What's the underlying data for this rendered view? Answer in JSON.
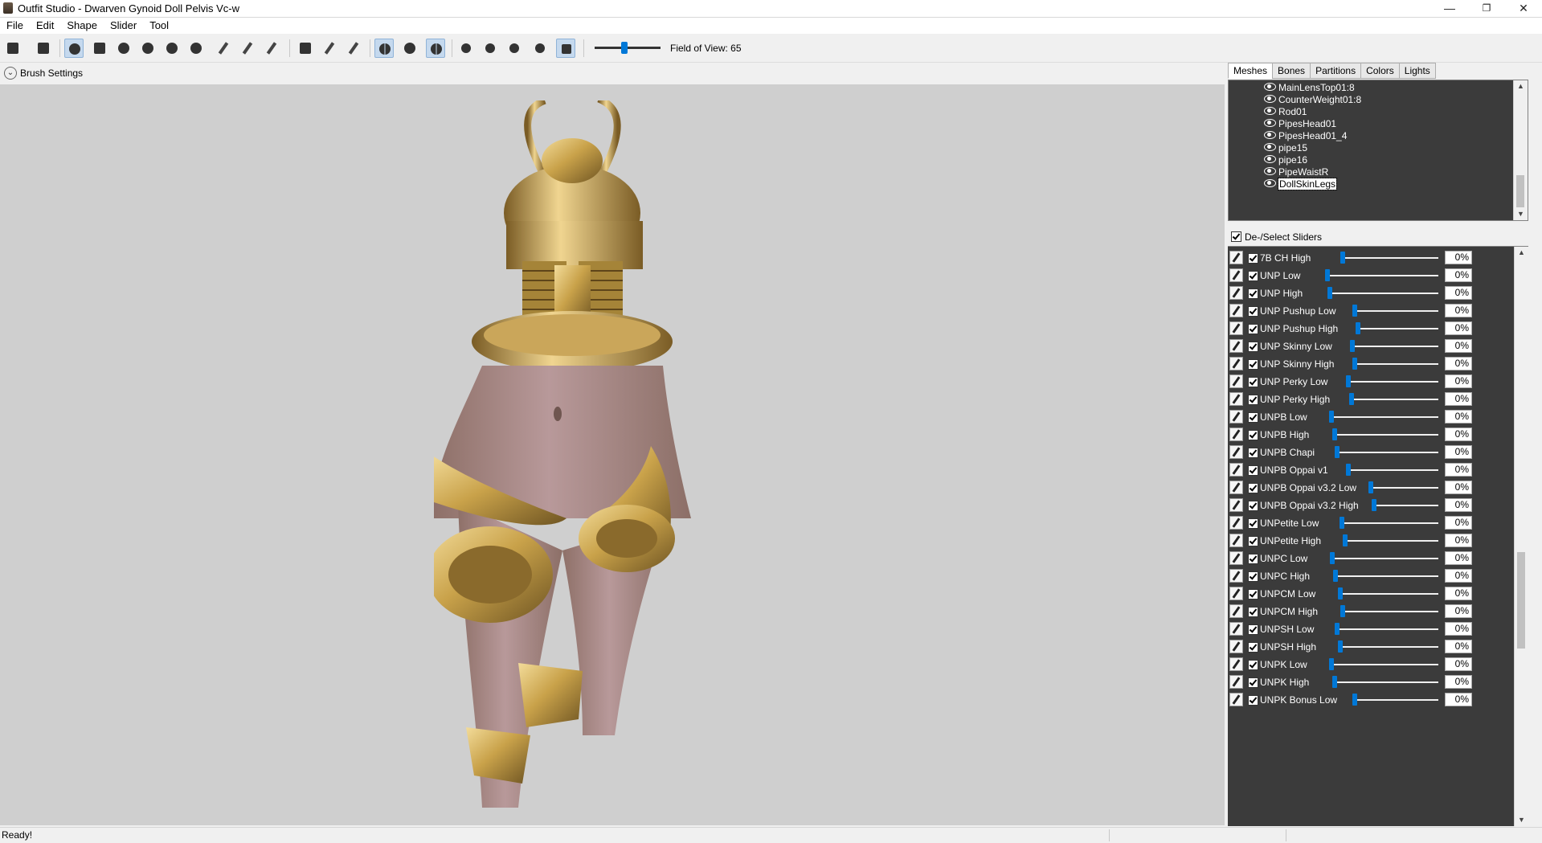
{
  "window": {
    "title": "Outfit Studio - Dwarven Gynoid Doll Pelvis Vc-w",
    "minimize": "—",
    "restore": "❐",
    "close": "✕"
  },
  "menu": [
    "File",
    "Edit",
    "Shape",
    "Slider",
    "Tool"
  ],
  "toolbar": {
    "fov_label": "Field of View: 65",
    "fov_value": 65
  },
  "brush_settings": {
    "label": "Brush Settings"
  },
  "tabs": [
    {
      "label": "Meshes",
      "active": true
    },
    {
      "label": "Bones",
      "active": false
    },
    {
      "label": "Partitions",
      "active": false
    },
    {
      "label": "Colors",
      "active": false
    },
    {
      "label": "Lights",
      "active": false
    }
  ],
  "meshes": [
    "MainLensTop01:8",
    "CounterWeight01:8",
    "Rod01",
    "PipesHead01",
    "PipesHead01_4",
    "pipe15",
    "pipe16",
    "PipeWaistR",
    "DollSkinLegs"
  ],
  "selected_mesh": "DollSkinLegs",
  "deselect_label": "De-/Select Sliders",
  "sliders": [
    {
      "name": "7B CH High",
      "value": "0%"
    },
    {
      "name": "UNP Low",
      "value": "0%"
    },
    {
      "name": "UNP High",
      "value": "0%"
    },
    {
      "name": "UNP Pushup Low",
      "value": "0%"
    },
    {
      "name": "UNP Pushup High",
      "value": "0%"
    },
    {
      "name": "UNP Skinny Low",
      "value": "0%"
    },
    {
      "name": "UNP Skinny High",
      "value": "0%"
    },
    {
      "name": "UNP Perky Low",
      "value": "0%"
    },
    {
      "name": "UNP Perky High",
      "value": "0%"
    },
    {
      "name": "UNPB Low",
      "value": "0%"
    },
    {
      "name": "UNPB High",
      "value": "0%"
    },
    {
      "name": "UNPB Chapi",
      "value": "0%"
    },
    {
      "name": "UNPB Oppai v1",
      "value": "0%"
    },
    {
      "name": "UNPB Oppai v3.2 Low",
      "value": "0%"
    },
    {
      "name": "UNPB Oppai v3.2 High",
      "value": "0%"
    },
    {
      "name": "UNPetite Low",
      "value": "0%"
    },
    {
      "name": "UNPetite High",
      "value": "0%"
    },
    {
      "name": "UNPC Low",
      "value": "0%"
    },
    {
      "name": "UNPC High",
      "value": "0%"
    },
    {
      "name": "UNPCM Low",
      "value": "0%"
    },
    {
      "name": "UNPCM High",
      "value": "0%"
    },
    {
      "name": "UNPSH Low",
      "value": "0%"
    },
    {
      "name": "UNPSH High",
      "value": "0%"
    },
    {
      "name": "UNPK Low",
      "value": "0%"
    },
    {
      "name": "UNPK High",
      "value": "0%"
    },
    {
      "name": "UNPK Bonus Low",
      "value": "0%"
    }
  ],
  "status": {
    "text": "Ready!"
  },
  "colors": {
    "accent": "#0078d7",
    "panel_dark": "#3b3b3b",
    "viewport_bg": "#cfcfcf",
    "gold": "#c9a24a",
    "skin": "#a98a82"
  }
}
